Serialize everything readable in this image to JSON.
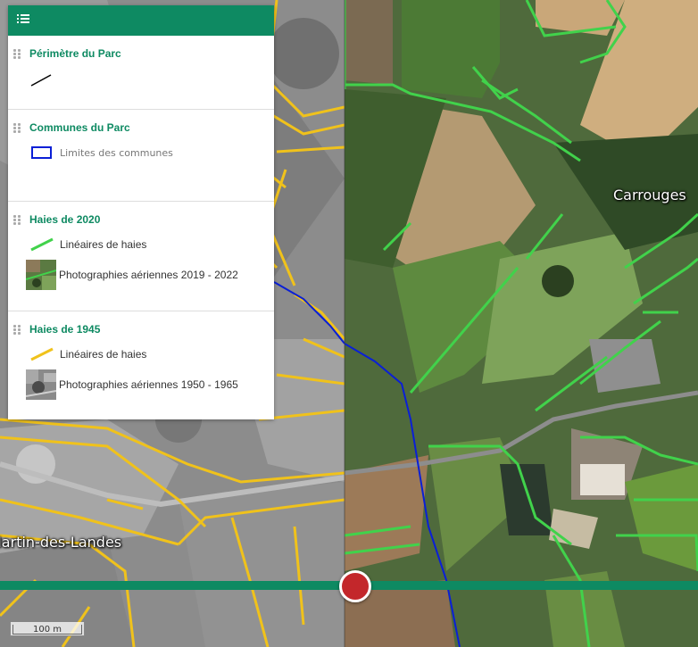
{
  "map": {
    "place_left": "Martin-des-Landes",
    "place_right": "Carrouges",
    "scale_label": "100 m",
    "colors": {
      "hedges_1945": "#f0c21b",
      "hedges_2020": "#41d24b",
      "commune_limits": "#0a1fd6",
      "swipe_bar": "#0e8a62",
      "swipe_handle": "#c3272b"
    }
  },
  "legend": {
    "header_icon": "list-icon",
    "sections": [
      {
        "title": "Périmètre du Parc",
        "items": [
          {
            "symbol": "black-line",
            "label": ""
          }
        ]
      },
      {
        "title": "Communes du Parc",
        "items": [
          {
            "symbol": "blue-rectangle",
            "label": "Limites des communes"
          }
        ]
      },
      {
        "title": "Haies de 2020",
        "items": [
          {
            "symbol": "green-line",
            "label": "Linéaires de haies"
          },
          {
            "symbol": "aerial-photo-thumb",
            "label": "Photographies aériennes 2019 - 2022"
          }
        ]
      },
      {
        "title": "Haies de 1945",
        "items": [
          {
            "symbol": "yellow-line",
            "label": "Linéaires de haies"
          },
          {
            "symbol": "aerial-photo-bw-thumb",
            "label": "Photographies aériennes 1950 - 1965"
          }
        ]
      }
    ]
  }
}
